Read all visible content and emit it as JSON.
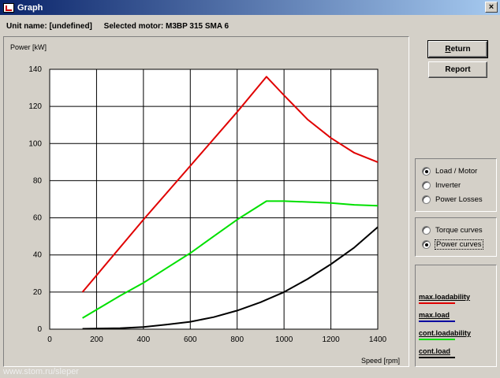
{
  "window": {
    "title": "Graph",
    "close_label": "×"
  },
  "header": {
    "unit_name": "Unit name: [undefined]",
    "selected_motor": "Selected motor: M3BP 315 SMA 6"
  },
  "buttons": {
    "return_pre": "",
    "return_u": "R",
    "return_post": "eturn",
    "report": "Report"
  },
  "view_group": {
    "options": [
      {
        "label": "Load / Motor",
        "checked": true
      },
      {
        "label": "Inverter",
        "checked": false
      },
      {
        "label": "Power Losses",
        "checked": false
      }
    ]
  },
  "curve_group": {
    "options": [
      {
        "label": "Torque curves",
        "checked": false
      },
      {
        "label": "Power curves",
        "checked": true
      }
    ]
  },
  "legend": [
    {
      "label": "max.loadability",
      "color": "#e00000"
    },
    {
      "label": "max.load",
      "color": "#0000a0"
    },
    {
      "label": "cont.loadability",
      "color": "#00e000"
    },
    {
      "label": "cont.load",
      "color": "#000000"
    }
  ],
  "watermark": "www.stom.ru/sleper",
  "chart_data": {
    "type": "line",
    "ylabel": "Power [kW]",
    "xlabel": "Speed [rpm]",
    "xlim": [
      0,
      1400
    ],
    "ylim": [
      0,
      140
    ],
    "x_ticks": [
      0,
      200,
      400,
      600,
      800,
      1000,
      1200,
      1400
    ],
    "y_ticks": [
      0,
      20,
      40,
      60,
      80,
      100,
      120,
      140
    ],
    "grid": true,
    "series": [
      {
        "name": "max.loadability",
        "color": "#e00000",
        "x": [
          140,
          400,
          600,
          800,
          925,
          1000,
          1100,
          1200,
          1300,
          1400
        ],
        "y": [
          20,
          59,
          88,
          117,
          136,
          126,
          113,
          103,
          95,
          90
        ]
      },
      {
        "name": "cont.loadability",
        "color": "#00e000",
        "x": [
          140,
          300,
          400,
          500,
          600,
          700,
          800,
          925,
          1000,
          1100,
          1200,
          1300,
          1400
        ],
        "y": [
          6,
          18,
          25,
          33,
          41,
          50,
          59,
          69,
          69,
          68.5,
          68,
          67,
          66.5
        ]
      },
      {
        "name": "cont.load",
        "color": "#000000",
        "x": [
          140,
          300,
          400,
          500,
          600,
          700,
          800,
          900,
          1000,
          1100,
          1200,
          1300,
          1400
        ],
        "y": [
          0.2,
          0.5,
          1.2,
          2.5,
          4,
          6.5,
          10,
          14.5,
          20,
          27,
          35,
          44,
          55
        ]
      }
    ]
  }
}
